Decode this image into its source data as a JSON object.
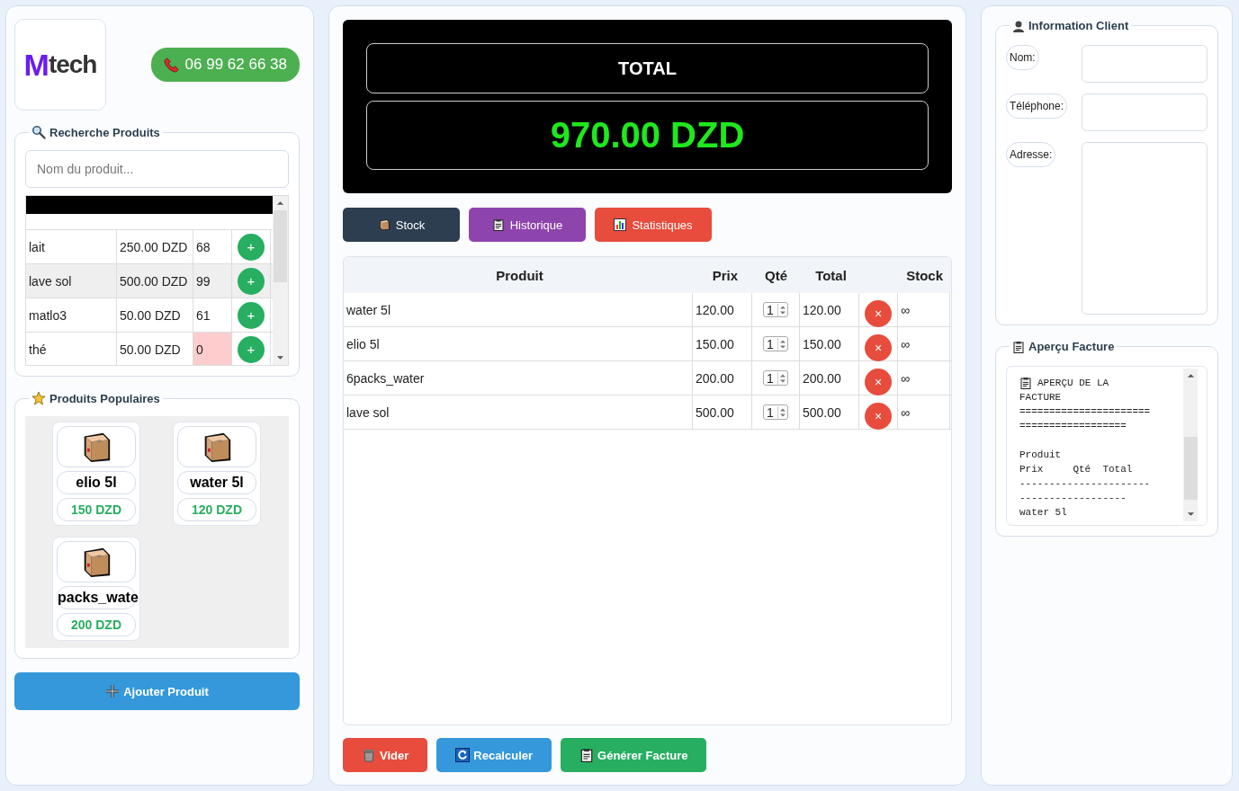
{
  "logo": {
    "letter": "M",
    "word": "tech"
  },
  "phone_button": {
    "label": "06 99 62 66 38"
  },
  "search_panel": {
    "title": "Recherche Produits",
    "placeholder": "Nom du produit...",
    "rows": [
      {
        "name": "lait",
        "price": "250.00 DZD",
        "stock": "68",
        "out_of_stock": false,
        "highlighted": false,
        "add": "+"
      },
      {
        "name": "lave sol",
        "price": "500.00 DZD",
        "stock": "99",
        "out_of_stock": false,
        "highlighted": true,
        "add": "+"
      },
      {
        "name": "matlo3",
        "price": "50.00 DZD",
        "stock": "61",
        "out_of_stock": false,
        "highlighted": false,
        "add": "+"
      },
      {
        "name": "thé",
        "price": "50.00 DZD",
        "stock": "0",
        "out_of_stock": true,
        "highlighted": false,
        "add": "+"
      }
    ]
  },
  "popular_panel": {
    "title": "Produits Populaires",
    "items": [
      {
        "name": "elio 5l",
        "price": "150 DZD"
      },
      {
        "name": "water 5l",
        "price": "120 DZD"
      },
      {
        "name": "packs_wate",
        "price": "200 DZD"
      }
    ]
  },
  "add_product_button": {
    "label": "Ajouter Produit"
  },
  "total": {
    "label": "TOTAL",
    "amount": "970.00 DZD"
  },
  "nav_buttons": [
    {
      "label": "Stock",
      "color": "#2c3e50"
    },
    {
      "label": "Historique",
      "color": "#8e44ad"
    },
    {
      "label": "Statistiques",
      "color": "#e74c3c"
    }
  ],
  "cart": {
    "columns": [
      "Produit",
      "Prix",
      "Qté",
      "Total",
      "Stock"
    ],
    "rows": [
      {
        "product": "water 5l",
        "price": "120.00",
        "qty": "1",
        "total": "120.00",
        "remove": "×",
        "stock": "∞"
      },
      {
        "product": "elio 5l",
        "price": "150.00",
        "qty": "1",
        "total": "150.00",
        "remove": "×",
        "stock": "∞"
      },
      {
        "product": "6packs_water",
        "price": "200.00",
        "qty": "1",
        "total": "200.00",
        "remove": "×",
        "stock": "∞"
      },
      {
        "product": "lave sol",
        "price": "500.00",
        "qty": "1",
        "total": "500.00",
        "remove": "×",
        "stock": "∞"
      }
    ]
  },
  "actions": [
    {
      "label": "Vider",
      "color": "#e74c3c"
    },
    {
      "label": "Recalculer",
      "color": "#3498db"
    },
    {
      "label": "Générer Facture",
      "color": "#27ae60"
    }
  ],
  "client_panel": {
    "title": "Information Client",
    "fields": [
      {
        "label": "Nom:",
        "kind": "input"
      },
      {
        "label": "Téléphone:",
        "kind": "input"
      },
      {
        "label": "Adresse:",
        "kind": "textarea"
      }
    ]
  },
  "preview_panel": {
    "title": "Aperçu Facture",
    "header_lines": [
      "APERÇU DE LA",
      "FACTURE",
      "======================",
      "=================="
    ],
    "body_lines": [
      "Produit",
      "Prix     Qté  Total",
      "----------------------",
      "------------------",
      "water 5l"
    ]
  }
}
